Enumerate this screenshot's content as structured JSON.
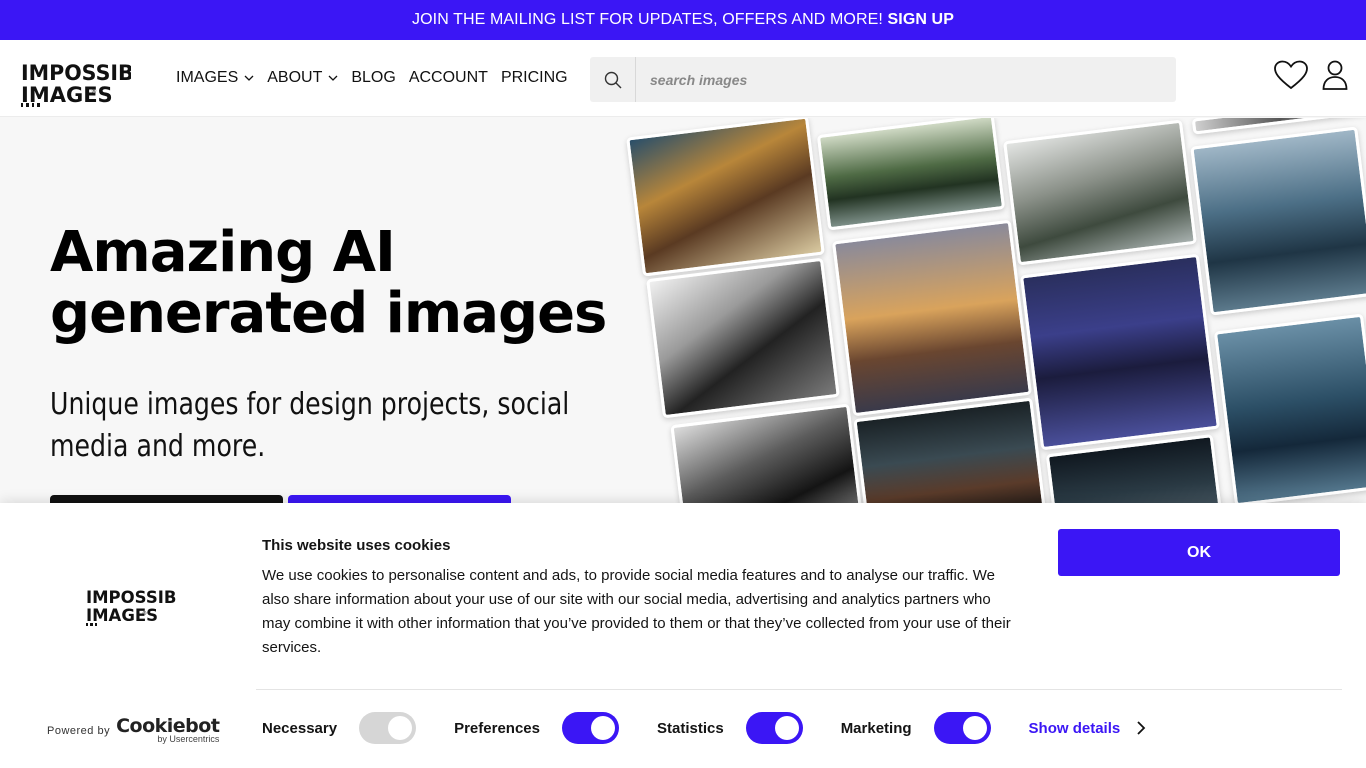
{
  "promo": {
    "text": "JOIN THE MAILING LIST FOR UPDATES, OFFERS AND MORE!",
    "link": "SIGN UP"
  },
  "header": {
    "logo_text": "IMPOSSIBLE IMAGES",
    "nav": [
      {
        "label": "IMAGES",
        "has_dropdown": true
      },
      {
        "label": "ABOUT",
        "has_dropdown": true
      },
      {
        "label": "BLOG",
        "has_dropdown": false
      },
      {
        "label": "ACCOUNT",
        "has_dropdown": false
      },
      {
        "label": "PRICING",
        "has_dropdown": false
      }
    ],
    "search": {
      "placeholder": "search images",
      "value": ""
    },
    "icons": [
      "heart-icon",
      "user-icon"
    ]
  },
  "hero": {
    "title": "Amazing AI generated images",
    "subtitle": "Unique images for design projects, social media and more."
  },
  "cookie": {
    "title": "This website uses cookies",
    "body": "We use cookies to personalise content and ads, to provide social media features and to analyse our traffic. We also share information about your use of our site with our social media, advertising and analytics partners who may combine it with other information that you’ve provided to them or that they’ve collected from your use of their services.",
    "ok_label": "OK",
    "powered_by": "Powered by",
    "cookiebot_brand": "Cookiebot",
    "cookiebot_sub": "by Usercentrics",
    "toggles": [
      {
        "label": "Necessary",
        "on": true,
        "disabled": true
      },
      {
        "label": "Preferences",
        "on": true
      },
      {
        "label": "Statistics",
        "on": true
      },
      {
        "label": "Marketing",
        "on": true
      }
    ],
    "show_details": "Show details"
  },
  "colors": {
    "accent": "#3b16f5",
    "text": "#141414",
    "hero_bg": "#f7f7f7"
  }
}
